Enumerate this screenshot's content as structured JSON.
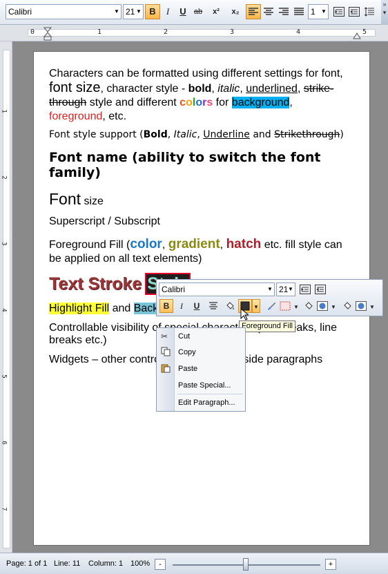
{
  "toolbar": {
    "font_name": "Calibri",
    "font_size": "21",
    "bold": "B",
    "italic": "I",
    "underline": "U",
    "strike": "ab",
    "superscript": "x²",
    "subscript": "x₂",
    "line_spacing": "1",
    "active_alignment": "left"
  },
  "ruler": {
    "h_numbers": [
      "0",
      "1",
      "2",
      "3",
      "4",
      "5"
    ],
    "v_numbers": [
      "1",
      "2",
      "3",
      "4",
      "5",
      "6",
      "7"
    ]
  },
  "doc": {
    "p1": {
      "t1": "Characters can be formatted using different settings for font, ",
      "t2": "font size",
      "t3": ", character style - ",
      "bold": "bold",
      "t4": ", ",
      "italic": "italic",
      "t5": ", ",
      "underlined": "underlined",
      "t6": ", ",
      "strike": "strike-through",
      "t7": " style and different ",
      "colors": [
        "c",
        "o",
        "l",
        "o",
        "r",
        "s"
      ],
      "color_values": [
        "#e8501e",
        "#f0a30a",
        "#2d9c2a",
        "#1e6fc9",
        "#8a2bbf",
        "#e64a7a"
      ],
      "t8": " for ",
      "background": "background",
      "background_color": "#00b0f0",
      "t9": ", ",
      "foreground": "foreground",
      "foreground_color": "#e02020",
      "t10": ", etc."
    },
    "p2": {
      "t1": "Font style support (",
      "bold": "Bold",
      "t2": ", ",
      "italic": "Italic",
      "t3": ", ",
      "underline": "Underline",
      "t4": " and ",
      "strike": "Strikethrough",
      "t5": ")"
    },
    "p3": "Font name (ability to switch the font family)",
    "p4": {
      "big": "Font",
      "small": " size"
    },
    "p5": "Superscript  / Subscript",
    "p6": {
      "t1": "Foreground Fill (",
      "color": "color",
      "t2": ", ",
      "gradient": "gradient",
      "t3": ", ",
      "hatch": "hatch",
      "t4": " etc. fill style can be applied on all text elements)"
    },
    "p7": {
      "t1": "Text Stroke ",
      "style": "Style"
    },
    "p8": {
      "highlight": "Highlight Fill",
      "t1": " and ",
      "back": "Back"
    },
    "p9": "Controllable visibility of special characters (line breaks, line breaks etc.)",
    "p10": {
      "t1": "Widgets – other contro",
      "t2": "inside paragraphs"
    }
  },
  "mini_toolbar": {
    "font_name": "Calibri",
    "font_size": "21",
    "tooltip": "Foreground Fill"
  },
  "context_menu": {
    "items": [
      "Cut",
      "Copy",
      "Paste",
      "Paste Special...",
      "Edit Paragraph..."
    ]
  },
  "status": {
    "page": "Page: 1 of 1",
    "line": "Line: 11",
    "column": "Column: 1",
    "zoom": "100%",
    "zoom_minus": "-",
    "zoom_plus": "+"
  }
}
